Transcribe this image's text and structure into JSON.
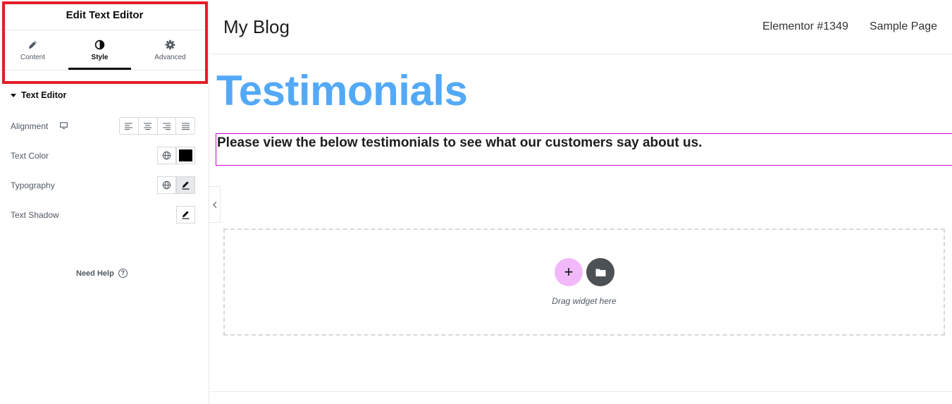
{
  "panel": {
    "title": "Edit Text Editor",
    "tabs": [
      {
        "label": "Content",
        "icon": "pencil-icon"
      },
      {
        "label": "Style",
        "icon": "contrast-icon",
        "active": true
      },
      {
        "label": "Advanced",
        "icon": "gear-icon"
      }
    ],
    "section": "Text Editor",
    "controls": {
      "alignment": "Alignment",
      "text_color": "Text Color",
      "text_color_value": "#000000",
      "typography": "Typography",
      "text_shadow": "Text Shadow"
    },
    "need_help": "Need Help",
    "help_glyph": "?"
  },
  "site": {
    "title": "My Blog",
    "nav": [
      "Elementor #1349",
      "Sample Page"
    ]
  },
  "content": {
    "heading": "Testimonials",
    "paragraph": "Please view the below testimonials to see what our customers say about us."
  },
  "dropzone": {
    "add_glyph": "+",
    "text": "Drag widget here"
  },
  "colors": {
    "heading": "#54a9f7",
    "highlight_border": "#e21e25",
    "selected_widget_border": "#d004d4",
    "add_button": "#f1b9fa",
    "folder_button": "#4b5155"
  }
}
